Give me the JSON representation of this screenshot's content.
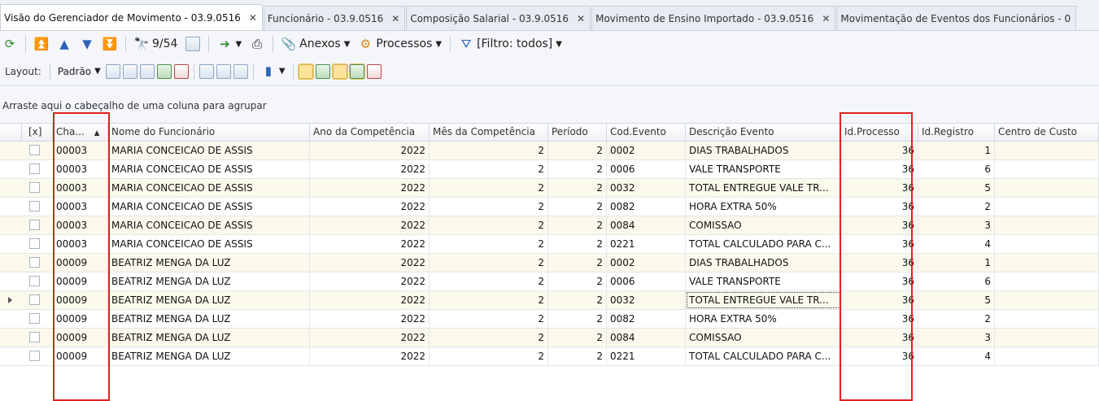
{
  "tabs": [
    {
      "label": "Visão do Gerenciador de Movimento - 03.9.0516",
      "active": true
    },
    {
      "label": "Funcionário - 03.9.0516",
      "active": false
    },
    {
      "label": "Composição Salarial - 03.9.0516",
      "active": false
    },
    {
      "label": "Movimento de Ensino Importado - 03.9.0516",
      "active": false
    },
    {
      "label": "Movimentação de Eventos dos Funcionários - 0",
      "active": false
    }
  ],
  "tab_close": "✕",
  "toolbar": {
    "record_counter": "9/54",
    "attachments_label": "Anexos",
    "processes_label": "Processos",
    "filter_label": "[Filtro: todos]"
  },
  "layout_bar": {
    "layout_label": "Layout:",
    "preset_label": "Padrão"
  },
  "group_panel_text": "Arraste aqui o cabeçalho de uma coluna para agrupar",
  "grid": {
    "columns": {
      "select": "[x]",
      "chapa": "Cha...",
      "nome": "Nome do Funcionário",
      "ano": "Ano da Competência",
      "mes": "Mês da Competência",
      "periodo": "Período",
      "cod": "Cod.Evento",
      "desc": "Descrição Evento",
      "idproc": "Id.Processo",
      "idreg": "Id.Registro",
      "custo": "Centro de Custo"
    },
    "sort_indicator": "▲",
    "rows": [
      {
        "chapa": "00003",
        "nome": "MARIA CONCEICAO DE ASSIS",
        "ano": "2022",
        "mes": "2",
        "periodo": "2",
        "cod": "0002",
        "desc": "DIAS TRABALHADOS",
        "idproc": "36",
        "idreg": "1"
      },
      {
        "chapa": "00003",
        "nome": "MARIA CONCEICAO DE ASSIS",
        "ano": "2022",
        "mes": "2",
        "periodo": "2",
        "cod": "0006",
        "desc": "VALE TRANSPORTE",
        "idproc": "36",
        "idreg": "6"
      },
      {
        "chapa": "00003",
        "nome": "MARIA CONCEICAO DE ASSIS",
        "ano": "2022",
        "mes": "2",
        "periodo": "2",
        "cod": "0032",
        "desc": "TOTAL ENTREGUE VALE TR...",
        "idproc": "36",
        "idreg": "5"
      },
      {
        "chapa": "00003",
        "nome": "MARIA CONCEICAO DE ASSIS",
        "ano": "2022",
        "mes": "2",
        "periodo": "2",
        "cod": "0082",
        "desc": "HORA EXTRA 50%",
        "idproc": "36",
        "idreg": "2"
      },
      {
        "chapa": "00003",
        "nome": "MARIA CONCEICAO DE ASSIS",
        "ano": "2022",
        "mes": "2",
        "periodo": "2",
        "cod": "0084",
        "desc": "COMISSAO",
        "idproc": "36",
        "idreg": "3"
      },
      {
        "chapa": "00003",
        "nome": "MARIA CONCEICAO DE ASSIS",
        "ano": "2022",
        "mes": "2",
        "periodo": "2",
        "cod": "0221",
        "desc": "TOTAL CALCULADO PARA C...",
        "idproc": "36",
        "idreg": "4"
      },
      {
        "chapa": "00009",
        "nome": "BEATRIZ MENGA DA LUZ",
        "ano": "2022",
        "mes": "2",
        "periodo": "2",
        "cod": "0002",
        "desc": "DIAS TRABALHADOS",
        "idproc": "36",
        "idreg": "1"
      },
      {
        "chapa": "00009",
        "nome": "BEATRIZ MENGA DA LUZ",
        "ano": "2022",
        "mes": "2",
        "periodo": "2",
        "cod": "0006",
        "desc": "VALE TRANSPORTE",
        "idproc": "36",
        "idreg": "6"
      },
      {
        "chapa": "00009",
        "nome": "BEATRIZ MENGA DA LUZ",
        "ano": "2022",
        "mes": "2",
        "periodo": "2",
        "cod": "0032",
        "desc": "TOTAL ENTREGUE VALE TR...",
        "idproc": "36",
        "idreg": "5"
      },
      {
        "chapa": "00009",
        "nome": "BEATRIZ MENGA DA LUZ",
        "ano": "2022",
        "mes": "2",
        "periodo": "2",
        "cod": "0082",
        "desc": "HORA EXTRA 50%",
        "idproc": "36",
        "idreg": "2"
      },
      {
        "chapa": "00009",
        "nome": "BEATRIZ MENGA DA LUZ",
        "ano": "2022",
        "mes": "2",
        "periodo": "2",
        "cod": "0084",
        "desc": "COMISSAO",
        "idproc": "36",
        "idreg": "3"
      },
      {
        "chapa": "00009",
        "nome": "BEATRIZ MENGA DA LUZ",
        "ano": "2022",
        "mes": "2",
        "periodo": "2",
        "cod": "0221",
        "desc": "TOTAL CALCULADO PARA C...",
        "idproc": "36",
        "idreg": "4"
      }
    ]
  },
  "colors": {
    "highlight_box": "#e0201f",
    "alt_row": "#fbf9ec"
  }
}
